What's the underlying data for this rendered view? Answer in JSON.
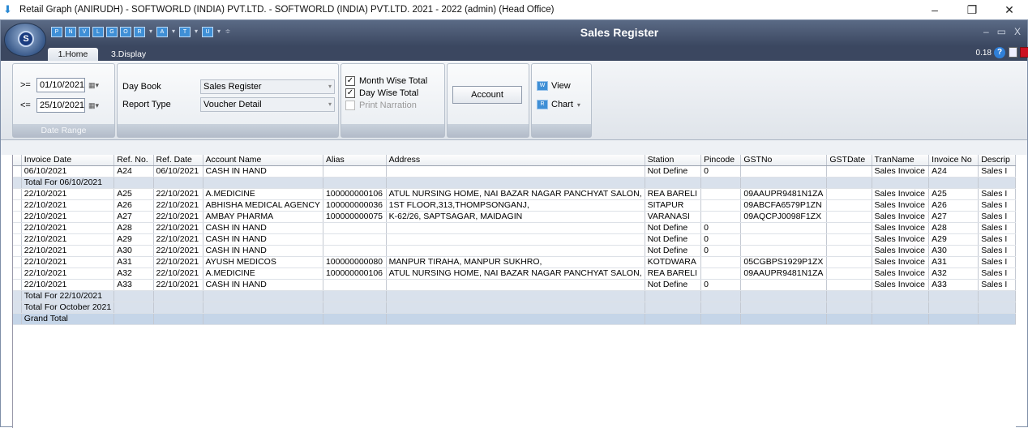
{
  "os_window": {
    "title": "Retail Graph (ANIRUDH) - SOFTWORLD (INDIA) PVT.LTD. - SOFTWORLD (INDIA) PVT.LTD.  2021 - 2022 (admin) (Head Office)",
    "minimize": "–",
    "restore": "❐",
    "close": "✕"
  },
  "ribbon": {
    "title": "Sales Register",
    "orb_letter": "S",
    "qat": [
      "P",
      "N",
      "V",
      "L",
      "G",
      "O",
      "R",
      "A",
      "T",
      "U"
    ],
    "window_buttons": [
      "–",
      "▭",
      "X"
    ],
    "version": "0.18",
    "tabs": [
      {
        "label": "1.Home"
      },
      {
        "label": "3.Display"
      }
    ]
  },
  "date_range": {
    "caption": "Date Range",
    "from_op": ">=",
    "from_date": "01/10/2021",
    "to_op": "<=",
    "to_date": "25/10/2021"
  },
  "book_group": {
    "day_book_label": "Day Book",
    "day_book_value": "Sales Register",
    "report_type_label": "Report Type",
    "report_type_value": "Voucher Detail"
  },
  "options": {
    "month_wise": "Month Wise Total",
    "day_wise": "Day Wise Total",
    "print_narration": "Print Narration"
  },
  "account_button": "Account",
  "view_button": "View",
  "chart_button": "Chart",
  "grid": {
    "columns": [
      "Invoice Date",
      "Ref. No.",
      "Ref. Date",
      "Account Name",
      "Alias",
      "Address",
      "Station",
      "Pincode",
      "GSTNo",
      "GSTDate",
      "TranName",
      "Invoice No",
      "Descrip"
    ],
    "rows": [
      {
        "type": "data",
        "cells": [
          "06/10/2021",
          "A24",
          "06/10/2021",
          "CASH IN HAND",
          "",
          "",
          "Not Define",
          "0",
          "",
          "",
          "Sales Invoice",
          "A24",
          "Sales I"
        ]
      },
      {
        "type": "total",
        "cells": [
          "Total For 06/10/2021",
          "",
          "",
          "",
          "",
          "",
          "",
          "",
          "",
          "",
          "",
          "",
          ""
        ]
      },
      {
        "type": "data",
        "cells": [
          "22/10/2021",
          "A25",
          "22/10/2021",
          "A.MEDICINE",
          "100000000106",
          "ATUL NURSING HOME, NAI BAZAR NAGAR PANCHYAT SALON,",
          "REA BARELI",
          "",
          "09AAUPR9481N1ZA",
          "",
          "Sales Invoice",
          "A25",
          "Sales I"
        ]
      },
      {
        "type": "data",
        "cells": [
          "22/10/2021",
          "A26",
          "22/10/2021",
          "ABHISHA MEDICAL AGENCY",
          "100000000036",
          "1ST FLOOR,313,THOMPSONGANJ,",
          "SITAPUR",
          "",
          "09ABCFA6579P1ZN",
          "",
          "Sales Invoice",
          "A26",
          "Sales I"
        ]
      },
      {
        "type": "data",
        "cells": [
          "22/10/2021",
          "A27",
          "22/10/2021",
          "AMBAY PHARMA",
          "100000000075",
          "K-62/26, SAPTSAGAR, MAIDAGIN",
          "VARANASI",
          "",
          "09AQCPJ0098F1ZX",
          "",
          "Sales Invoice",
          "A27",
          "Sales I"
        ]
      },
      {
        "type": "data",
        "cells": [
          "22/10/2021",
          "A28",
          "22/10/2021",
          "CASH IN HAND",
          "",
          "",
          "Not Define",
          "0",
          "",
          "",
          "Sales Invoice",
          "A28",
          "Sales I"
        ]
      },
      {
        "type": "data",
        "cells": [
          "22/10/2021",
          "A29",
          "22/10/2021",
          "CASH IN HAND",
          "",
          "",
          "Not Define",
          "0",
          "",
          "",
          "Sales Invoice",
          "A29",
          "Sales I"
        ]
      },
      {
        "type": "data",
        "cells": [
          "22/10/2021",
          "A30",
          "22/10/2021",
          "CASH IN HAND",
          "",
          "",
          "Not Define",
          "0",
          "",
          "",
          "Sales Invoice",
          "A30",
          "Sales I"
        ]
      },
      {
        "type": "data",
        "cells": [
          "22/10/2021",
          "A31",
          "22/10/2021",
          "AYUSH MEDICOS",
          "100000000080",
          "MANPUR TIRAHA, MANPUR SUKHRO,",
          "KOTDWARA",
          "",
          "05CGBPS1929P1ZX",
          "",
          "Sales Invoice",
          "A31",
          "Sales I"
        ]
      },
      {
        "type": "data",
        "cells": [
          "22/10/2021",
          "A32",
          "22/10/2021",
          "A.MEDICINE",
          "100000000106",
          "ATUL NURSING HOME, NAI BAZAR NAGAR PANCHYAT SALON,",
          "REA BARELI",
          "",
          "09AAUPR9481N1ZA",
          "",
          "Sales Invoice",
          "A32",
          "Sales I"
        ]
      },
      {
        "type": "data",
        "cells": [
          "22/10/2021",
          "A33",
          "22/10/2021",
          "CASH IN HAND",
          "",
          "",
          "Not Define",
          "0",
          "",
          "",
          "Sales Invoice",
          "A33",
          "Sales I"
        ]
      },
      {
        "type": "total",
        "cells": [
          "Total For 22/10/2021",
          "",
          "",
          "",
          "",
          "",
          "",
          "",
          "",
          "",
          "",
          "",
          ""
        ]
      },
      {
        "type": "total",
        "cells": [
          "Total For October 2021",
          "",
          "",
          "",
          "",
          "",
          "",
          "",
          "",
          "",
          "",
          "",
          ""
        ]
      },
      {
        "type": "grand",
        "cells": [
          "Grand Total",
          "",
          "",
          "",
          "",
          "",
          "",
          "",
          "",
          "",
          "",
          "",
          ""
        ]
      }
    ]
  }
}
